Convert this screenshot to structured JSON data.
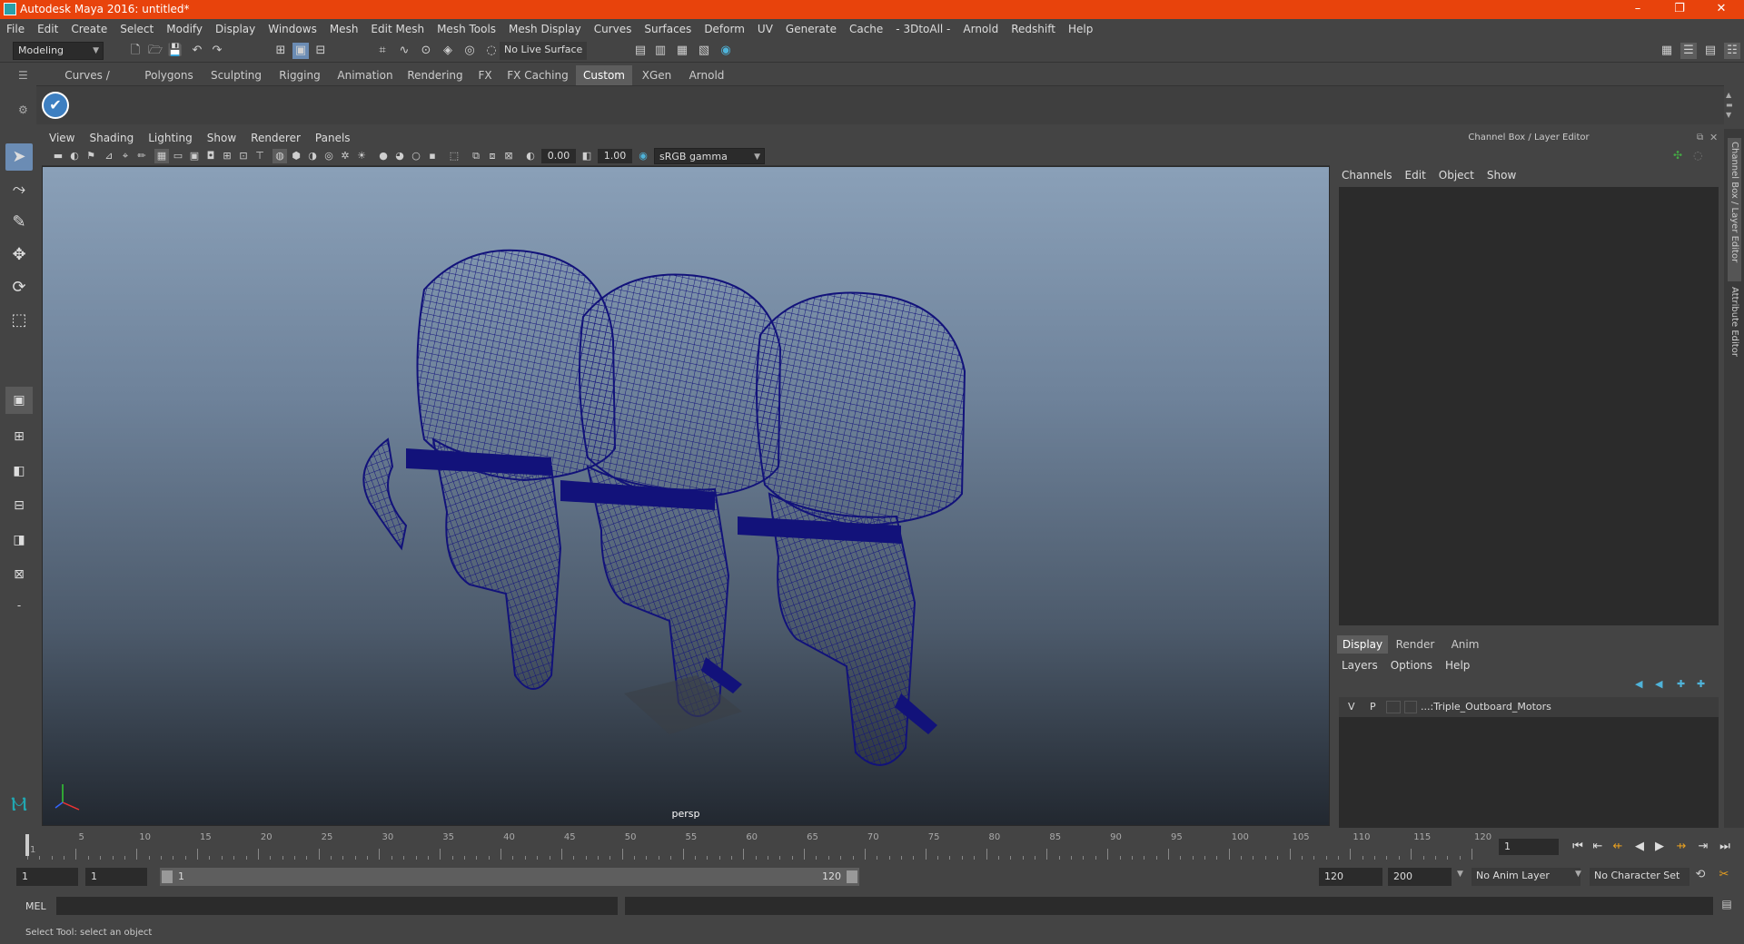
{
  "window": {
    "title": "Autodesk Maya 2016: untitled*"
  },
  "menubar": [
    "File",
    "Edit",
    "Create",
    "Select",
    "Modify",
    "Display",
    "Windows",
    "Mesh",
    "Edit Mesh",
    "Mesh Tools",
    "Mesh Display",
    "Curves",
    "Surfaces",
    "Deform",
    "UV",
    "Generate",
    "Cache",
    "- 3DtoAll -",
    "Arnold",
    "Redshift",
    "Help"
  ],
  "statusline": {
    "mode": "Modeling",
    "live_surface": "No Live Surface"
  },
  "shelf": {
    "tabs": [
      "Curves / Surfaces",
      "Polygons",
      "Sculpting",
      "Rigging",
      "Animation",
      "Rendering",
      "FX",
      "FX Caching",
      "Custom",
      "XGen",
      "Arnold"
    ],
    "active": "Custom"
  },
  "viewport": {
    "menus": [
      "View",
      "Shading",
      "Lighting",
      "Show",
      "Renderer",
      "Panels"
    ],
    "exposure": "0.00",
    "gamma": "1.00",
    "color_space": "sRGB gamma",
    "camera_label": "persp"
  },
  "channelbox": {
    "header": "Channel Box / Layer Editor",
    "menus": [
      "Channels",
      "Edit",
      "Object",
      "Show"
    ],
    "layer_tabs": [
      "Display",
      "Render",
      "Anim"
    ],
    "layer_menus": [
      "Layers",
      "Options",
      "Help"
    ],
    "layer": {
      "v": "V",
      "p": "P",
      "name": "...:Triple_Outboard_Motors"
    }
  },
  "side_tabs": {
    "channel_box": "Channel Box / Layer Editor",
    "attribute_editor": "Attribute Editor"
  },
  "timeline": {
    "labels": [
      "1",
      "5",
      "10",
      "15",
      "20",
      "25",
      "30",
      "35",
      "40",
      "45",
      "50",
      "55",
      "60",
      "65",
      "70",
      "75",
      "80",
      "85",
      "90",
      "95",
      "100",
      "105",
      "110",
      "115",
      "120"
    ],
    "current_frame": "1"
  },
  "range": {
    "start": "1",
    "playback_start": "1",
    "slider_start": "1",
    "slider_end": "120",
    "playback_end": "120",
    "end": "200",
    "anim_layer": "No Anim Layer",
    "character_set": "No Character Set"
  },
  "commandline": {
    "label": "MEL"
  },
  "statusbar": {
    "message": "Select Tool: select an object"
  },
  "colors": {
    "titlebar": "#e8430c",
    "wireframe": "#12127a",
    "selected_tool": "#6b8cb4"
  }
}
